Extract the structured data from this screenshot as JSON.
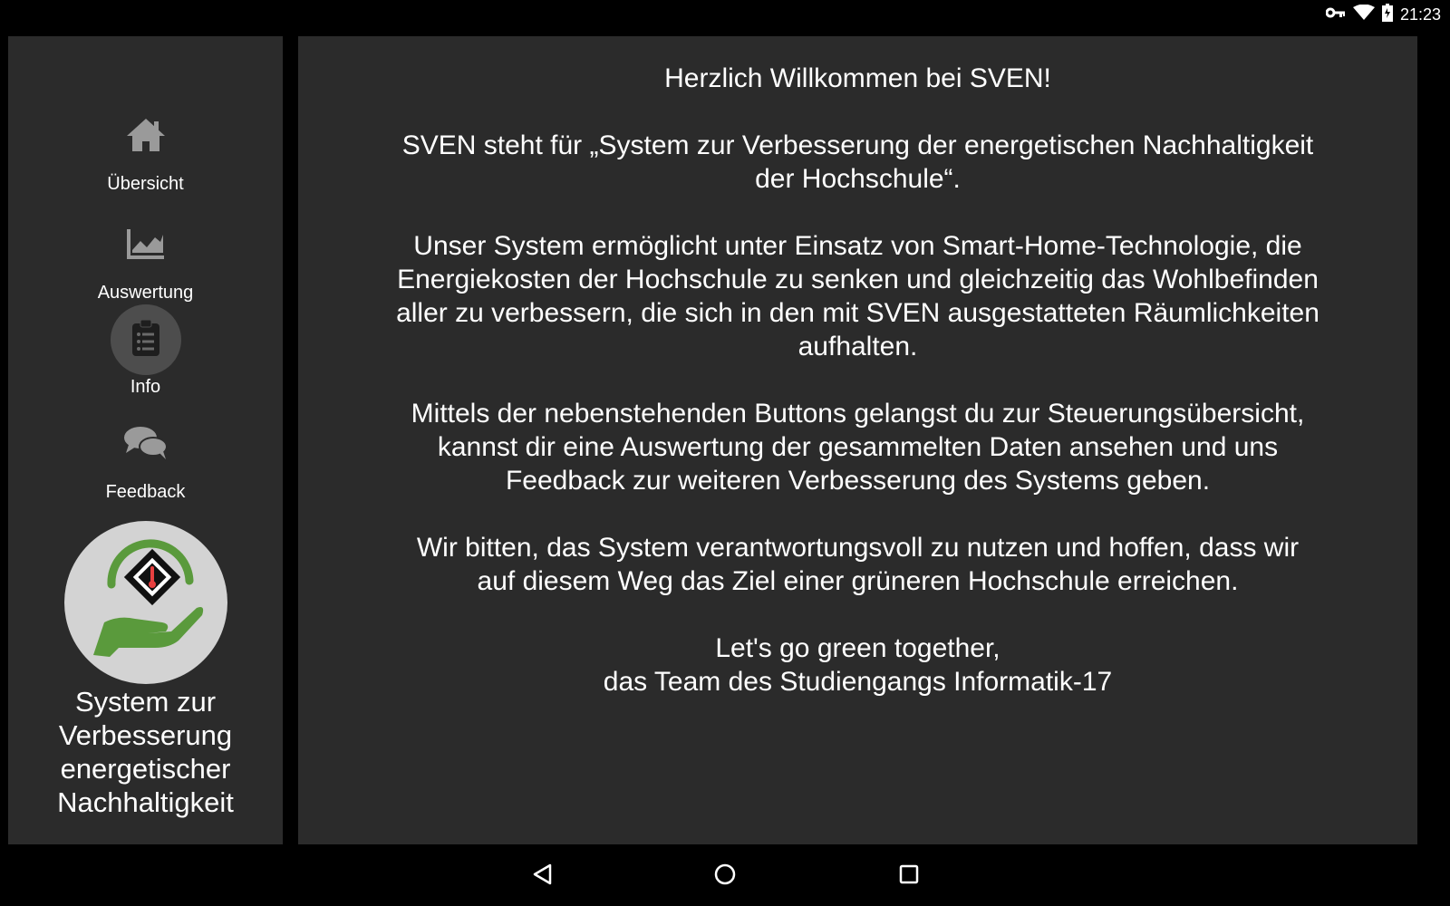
{
  "status_bar": {
    "time": "21:23",
    "icons": [
      "vpn-key-icon",
      "wifi-icon",
      "battery-icon"
    ]
  },
  "sidebar": {
    "items": [
      {
        "label": "Übersicht",
        "icon": "home-icon",
        "active": false
      },
      {
        "label": "Auswertung",
        "icon": "chart-icon",
        "active": false
      },
      {
        "label": "Info",
        "icon": "clipboard-icon",
        "active": true
      },
      {
        "label": "Feedback",
        "icon": "chat-bubbles-icon",
        "active": false
      }
    ],
    "brand_lines": [
      "System zur",
      "Verbesserung",
      "energetischer",
      "Nachhaltigkeit"
    ]
  },
  "main": {
    "heading": "Herzlich Willkommen bei SVEN!",
    "para1_lines": [
      "SVEN steht für „System zur Verbesserung der energetischen Nachhaltigkeit",
      "der Hochschule“."
    ],
    "para2_lines": [
      "Unser System ermöglicht unter Einsatz von Smart-Home-Technologie, die",
      "Energiekosten der Hochschule zu senken und gleichzeitig das Wohlbefinden",
      "aller zu verbessern, die sich in den mit SVEN ausgestatteten Räumlichkeiten",
      "aufhalten."
    ],
    "para3_lines": [
      "Mittels der nebenstehenden Buttons gelangst du zur Steuerungsübersicht,",
      "kannst dir eine Auswertung der gesammelten Daten ansehen und uns",
      "Feedback zur weiteren Verbesserung des Systems geben."
    ],
    "para4_lines": [
      "Wir bitten, das System verantwortungsvoll zu nutzen und hoffen, dass wir",
      "auf diesem Weg das Ziel einer grüneren Hochschule erreichen."
    ],
    "closing_lines": [
      "Let's go green together,",
      "das Team des Studiengangs Informatik-17"
    ]
  },
  "colors": {
    "background": "#000000",
    "panel": "#2b2b2b",
    "active_circle": "#4d4d4d",
    "icon_gray": "#9a9a9a",
    "logo_green": "#5a9a3c",
    "logo_bg": "#d3d3d3"
  }
}
